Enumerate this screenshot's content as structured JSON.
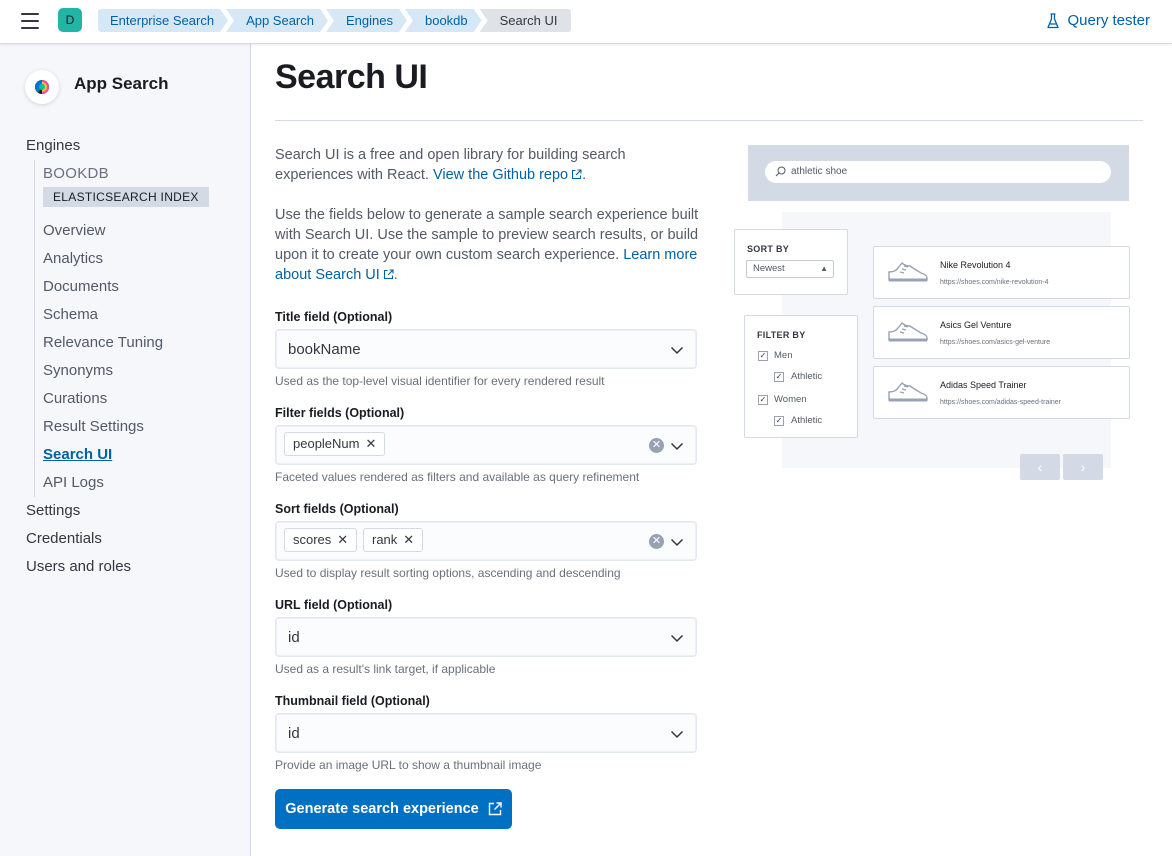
{
  "header": {
    "space_initial": "D",
    "breadcrumbs": [
      "Enterprise Search",
      "App Search",
      "Engines",
      "bookdb",
      "Search UI"
    ],
    "query_tester": "Query tester"
  },
  "sidebar": {
    "app_title": "App Search",
    "engines": "Engines",
    "engine_name": "BOOKDB",
    "engine_badge": "ELASTICSEARCH INDEX",
    "items": [
      "Overview",
      "Analytics",
      "Documents",
      "Schema",
      "Relevance Tuning",
      "Synonyms",
      "Curations",
      "Result Settings",
      "Search UI",
      "API Logs"
    ],
    "bottom_items": [
      "Settings",
      "Credentials",
      "Users and roles"
    ]
  },
  "main": {
    "title": "Search UI",
    "desc1_text": "Search UI is a free and open library for building search experiences with React.",
    "desc1_link": "View the Github repo",
    "desc2_text": "Use the fields below to generate a sample search experience built with Search UI. Use the sample to preview search results, or build upon it to create your own custom search experience.",
    "desc2_link": "Learn more about Search UI",
    "title_field": {
      "label": "Title field (Optional)",
      "value": "bookName",
      "help": "Used as the top-level visual identifier for every rendered result"
    },
    "filter_fields": {
      "label": "Filter fields (Optional)",
      "chips": [
        "peopleNum"
      ],
      "help": "Faceted values rendered as filters and available as query refinement"
    },
    "sort_fields": {
      "label": "Sort fields (Optional)",
      "chips": [
        "scores",
        "rank"
      ],
      "help": "Used to display result sorting options, ascending and descending"
    },
    "url_field": {
      "label": "URL field (Optional)",
      "value": "id",
      "help": "Used as a result's link target, if applicable"
    },
    "thumbnail_field": {
      "label": "Thumbnail field (Optional)",
      "value": "id",
      "help": "Provide an image URL to show a thumbnail image"
    },
    "generate_button": "Generate search experience"
  },
  "preview": {
    "search_text": "athletic shoe",
    "sort_by": "SORT BY",
    "sort_value": "Newest",
    "filter_by": "FILTER BY",
    "filters": [
      "Men",
      "Athletic",
      "Women",
      "Athletic"
    ],
    "results": [
      {
        "title": "Nike Revolution 4",
        "url": "https://shoes.com/nike-revolution-4"
      },
      {
        "title": "Asics Gel Venture",
        "url": "https://shoes.com/asics-gel-venture"
      },
      {
        "title": "Adidas Speed Trainer",
        "url": "https://shoes.com/adidas-speed-trainer"
      }
    ],
    "prev": "‹",
    "next": "›"
  },
  "colors": {
    "accent": "#0071c2",
    "link": "#0061a6",
    "sidebar_bg": "#f5f7fa",
    "avatar": "#20b5a4"
  }
}
